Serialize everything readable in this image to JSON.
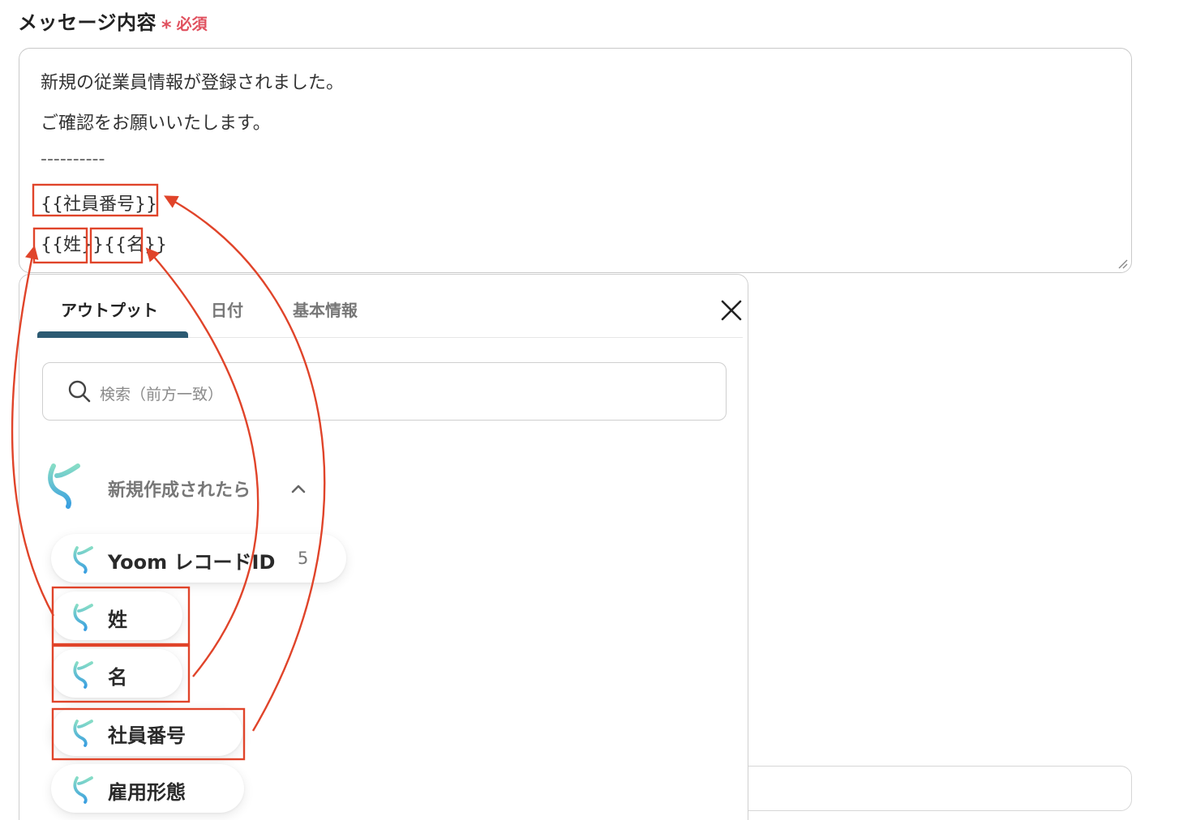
{
  "field": {
    "title": "メッセージ内容",
    "required_star": "*",
    "required_text": "必須"
  },
  "message": {
    "lines": [
      "新規の従業員情報が登録されました。",
      "ご確認をお願いいたします。",
      "----------",
      "{{社員番号}}",
      "{{姓}}{{名}}"
    ]
  },
  "popup": {
    "tabs": [
      {
        "label": "アウトプット",
        "active": true
      },
      {
        "label": "日付",
        "active": false
      },
      {
        "label": "基本情報",
        "active": false
      }
    ],
    "search_placeholder": "検索（前方一致）",
    "group": {
      "label": "新規作成されたら",
      "expanded": true
    },
    "items": [
      {
        "label": "Yoom レコードID",
        "value": "5"
      },
      {
        "label": "姓",
        "value": ""
      },
      {
        "label": "名",
        "value": ""
      },
      {
        "label": "社員番号",
        "value": ""
      },
      {
        "label": "雇用形態",
        "value": ""
      }
    ]
  },
  "colors": {
    "required": "#e0505e",
    "highlight": "#e0442a",
    "tab_underline": "#2c5a72",
    "icon_gradient_start": "#7fd6c4",
    "icon_gradient_end": "#3ea7e0"
  },
  "icons": {
    "close": "close-icon",
    "search": "search-icon",
    "group": "yoom-logo-icon",
    "collapse": "chevron-up-icon",
    "item": "yoom-logo-icon"
  }
}
